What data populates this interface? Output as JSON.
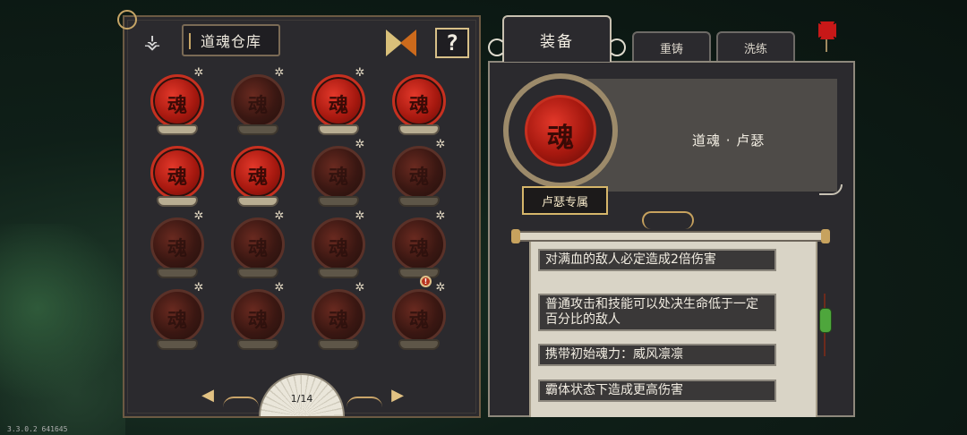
{
  "version": "3.3.0.2 641645",
  "inventory": {
    "title": "道魂仓库",
    "help_label": "?",
    "slots": [
      {
        "owned": true,
        "star": true
      },
      {
        "owned": false,
        "star": true
      },
      {
        "owned": true,
        "star": true
      },
      {
        "owned": true,
        "star": false
      },
      {
        "owned": true,
        "star": false
      },
      {
        "owned": true,
        "star": false
      },
      {
        "owned": false,
        "star": true
      },
      {
        "owned": false,
        "star": true
      },
      {
        "owned": false,
        "star": true
      },
      {
        "owned": false,
        "star": true
      },
      {
        "owned": false,
        "star": true
      },
      {
        "owned": false,
        "star": true
      },
      {
        "owned": false,
        "star": true
      },
      {
        "owned": false,
        "star": true
      },
      {
        "owned": false,
        "star": true
      },
      {
        "owned": false,
        "star": true
      }
    ],
    "glyph": "魂",
    "badge_label": "!",
    "page_label": "1/14",
    "prev_icon": "◀",
    "next_icon": "▶"
  },
  "tabs": {
    "equip": "装备",
    "recast": "重铸",
    "refine": "洗练"
  },
  "detail": {
    "name": "道魂 · 卢瑟",
    "exclusive": "卢瑟专属",
    "effects": [
      "对满血的敌人必定造成2倍伤害",
      "普通攻击和技能可以处决生命低于一定百分比的敌人",
      "携带初始魂力：威风凛凛",
      "霸体状态下造成更高伤害"
    ]
  },
  "colors": {
    "panel": "#2b2a2e",
    "gold": "#c6a566",
    "orb_red": "#d02a1c"
  }
}
